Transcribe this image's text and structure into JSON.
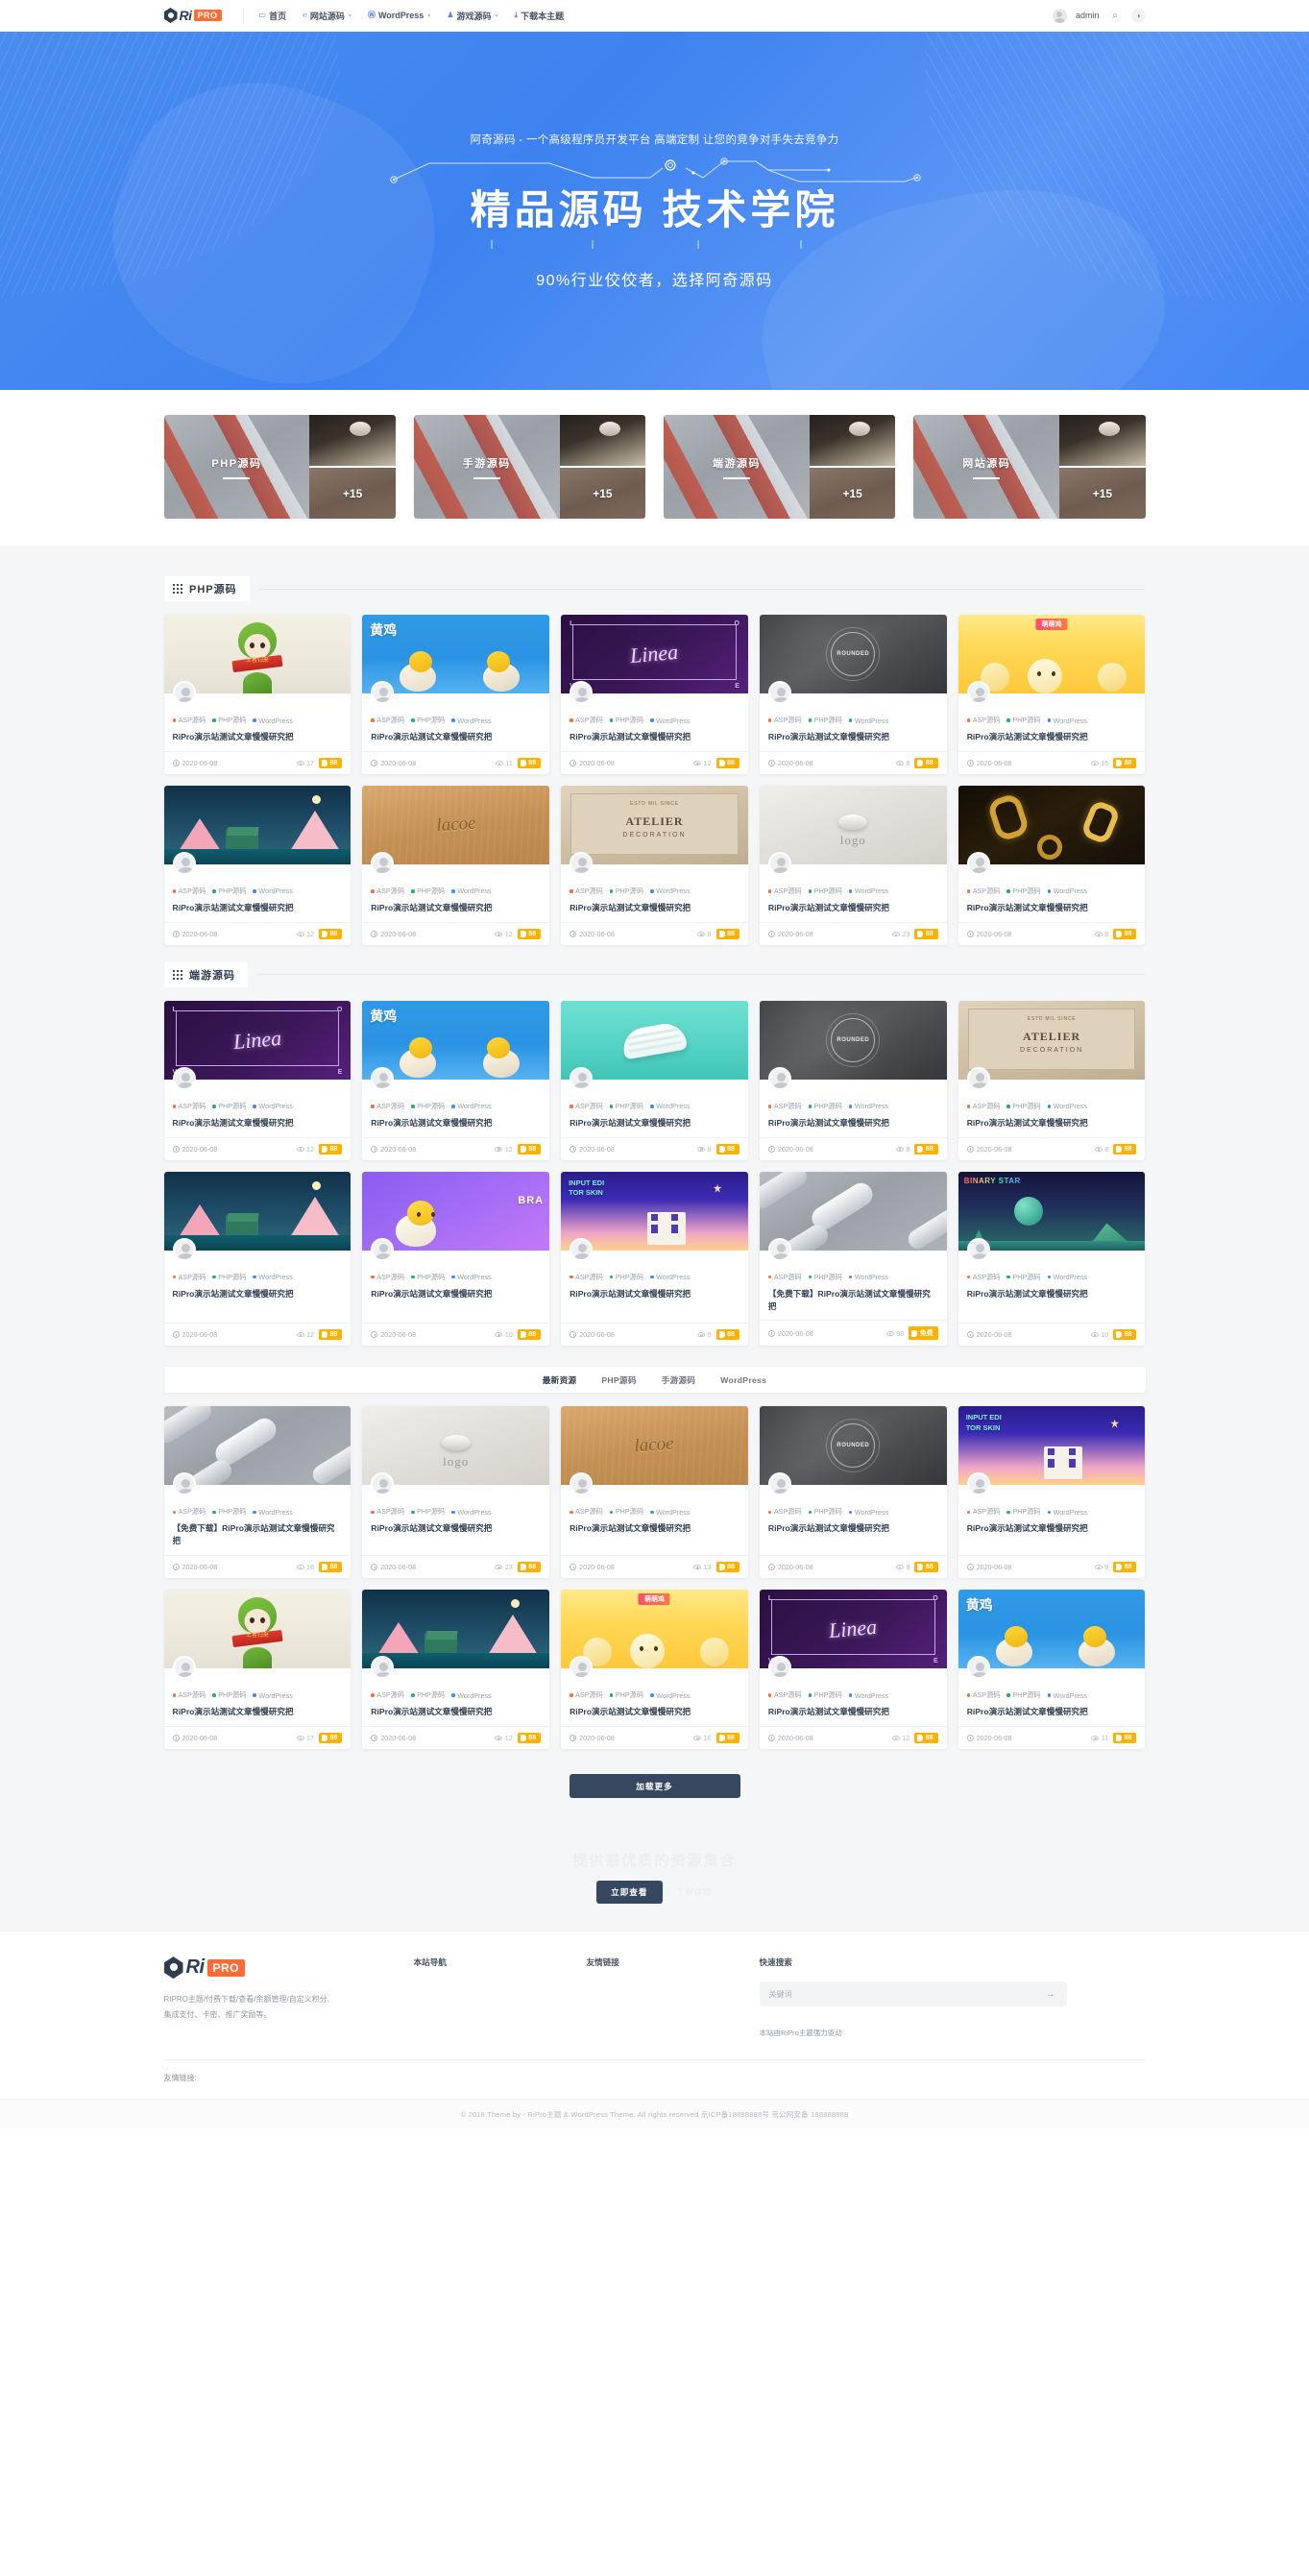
{
  "site": {
    "logo_ri": "Ri",
    "logo_pro": "PRO"
  },
  "header": {
    "nav": [
      {
        "label": "首页",
        "icon": "monitor-icon",
        "caret": false
      },
      {
        "label": "网站源码",
        "icon": "code-icon",
        "caret": true
      },
      {
        "label": "WordPress",
        "icon": "wordpress-icon",
        "caret": true
      },
      {
        "label": "游戏源码",
        "icon": "game-icon",
        "caret": true
      },
      {
        "label": "下载本主题",
        "icon": "download-icon",
        "caret": false
      }
    ],
    "user": "admin",
    "search_icon": "search-icon",
    "theme_icon": "moon-icon"
  },
  "hero": {
    "subtitle": "阿奇源码 - 一个高级程序员开发平台 高端定制 让您的竞争对手失去竞争力",
    "title": "精品源码 技术学院",
    "tagline": "90%行业佼佼者，选择阿奇源码"
  },
  "categories": [
    {
      "label": "PHP源码",
      "count": "+15"
    },
    {
      "label": "手游源码",
      "count": "+15"
    },
    {
      "label": "端游源码",
      "count": "+15"
    },
    {
      "label": "网站源码",
      "count": "+15"
    }
  ],
  "card_defaults": {
    "title": "RiPro演示站测试文章慢慢研究把",
    "date": "2020-06-08",
    "price": "88",
    "tags": [
      {
        "label": "ASP源码",
        "color": "#ff6b35"
      },
      {
        "label": "PHP源码",
        "color": "#27ae60"
      },
      {
        "label": "WordPress",
        "color": "#3d8bfd"
      }
    ]
  },
  "sections": [
    {
      "id": "php",
      "title": "PHP源码",
      "rows": [
        [
          {
            "views": "17",
            "art": "mascot-green"
          },
          {
            "views": "11",
            "art": "yellow-chick"
          },
          {
            "views": "12",
            "art": "linea-purple"
          },
          {
            "views": "8",
            "art": "stone-badge"
          },
          {
            "views": "16",
            "art": "cute-chicks"
          }
        ],
        [
          {
            "views": "12",
            "art": "pink-mountain"
          },
          {
            "views": "12",
            "art": "wood-logo"
          },
          {
            "views": "8",
            "art": "atelier-card"
          },
          {
            "views": "23",
            "art": "logo-stamp"
          },
          {
            "views": "8",
            "art": "gold-chain"
          }
        ]
      ]
    },
    {
      "id": "duanyou",
      "title": "端游源码",
      "rows": [
        [
          {
            "views": "12",
            "art": "linea-purple"
          },
          {
            "views": "12",
            "art": "yellow-chick"
          },
          {
            "views": "8",
            "art": "mint-shoe"
          },
          {
            "views": "8",
            "art": "stone-badge"
          },
          {
            "views": "8",
            "art": "atelier-card"
          }
        ],
        [
          {
            "views": "12",
            "art": "pink-mountain"
          },
          {
            "views": "10",
            "art": "purple-chick"
          },
          {
            "views": "9",
            "art": "input-edi"
          },
          {
            "views": "98",
            "art": "metal-tube",
            "price": "免费",
            "free": true,
            "title": "【免费下载】RiPro演示站测试文章慢慢研究把"
          },
          {
            "views": "10",
            "art": "binary-star"
          }
        ]
      ]
    }
  ],
  "tabs": [
    {
      "label": "最新资源",
      "active": true
    },
    {
      "label": "PHP源码",
      "active": false
    },
    {
      "label": "手游源码",
      "active": false
    },
    {
      "label": "WordPress",
      "active": false
    }
  ],
  "latest_rows": [
    [
      {
        "views": "16",
        "art": "metal-tube",
        "title": "【免费下载】RiPro演示站测试文章慢慢研究把"
      },
      {
        "views": "23",
        "art": "logo-stamp"
      },
      {
        "views": "13",
        "art": "wood-logo"
      },
      {
        "views": "8",
        "art": "stone-badge"
      },
      {
        "views": "9",
        "art": "input-edi"
      }
    ],
    [
      {
        "views": "17",
        "art": "mascot-green"
      },
      {
        "views": "12",
        "art": "pink-mountain"
      },
      {
        "views": "16",
        "art": "cute-chicks"
      },
      {
        "views": "12",
        "art": "linea-purple"
      },
      {
        "views": "11",
        "art": "yellow-chick"
      }
    ]
  ],
  "loadmore": "加载更多",
  "cta": {
    "title": "提供最优质的资源集合",
    "button": "立即查看",
    "link": "了解详情"
  },
  "footer": {
    "desc_line1": "RIPRO主题/付费下载/查看/余额管理/自定义积分,",
    "desc_line2": "集成支付、卡密、推广奖励等。",
    "col_nav_title": "本站导航",
    "col_links_title": "友情链接",
    "col_search_title": "快速搜索",
    "search_placeholder": "关键词",
    "powered": "本站由RiPro主题强力驱动",
    "friend_label": "友情链接:",
    "copyright": "© 2018 Theme by -  RiPro主题 & WordPress Theme. All rights reserved  京ICP备18888888号  京公网安备 188888888"
  }
}
